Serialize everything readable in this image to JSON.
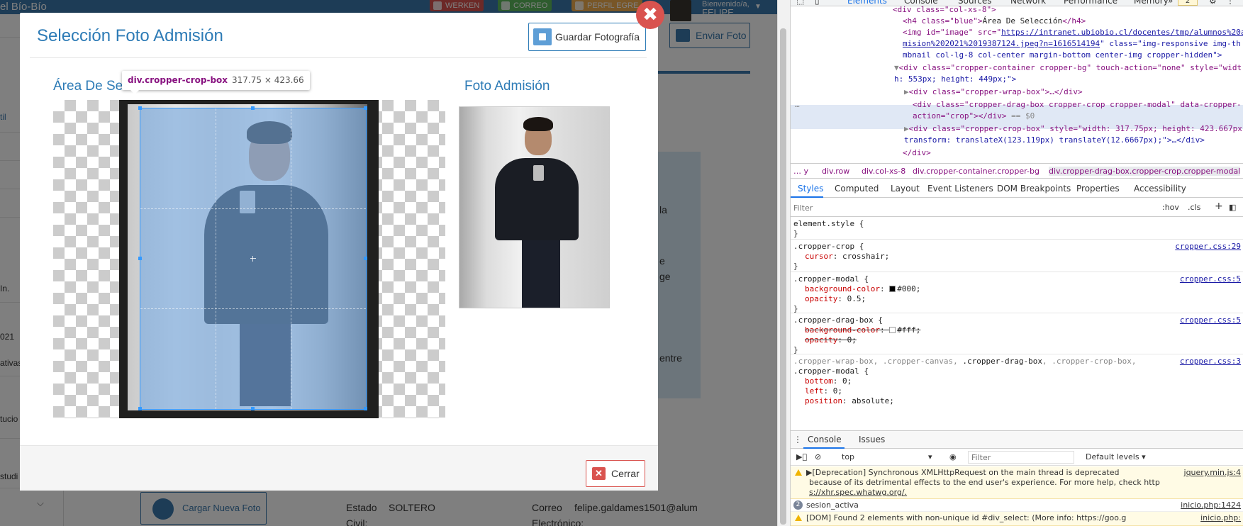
{
  "topbar": {
    "brand": "el Bío-Bío",
    "buttons": [
      "WERKEN",
      "CORREO",
      "PERFIL EGRE"
    ],
    "welcome": "Bienvenido/a,",
    "user": "FELIPE"
  },
  "page": {
    "left_labels": [
      "til",
      "In.",
      "021",
      "ativas",
      "tucio",
      "studi"
    ],
    "send_photo_label": "Enviar Foto",
    "upload_photo_label": "Cargar Nueva Foto",
    "info_snippets": [
      "la",
      "e",
      "ge",
      "entre"
    ],
    "fields": {
      "estado_label": "Estado",
      "estado_label_2": "Civil:",
      "estado_value": "SOLTERO",
      "correo_label": "Correo",
      "correo_label_2": "Electrónico:",
      "correo_value": "felipe.galdames1501@alum"
    }
  },
  "modal": {
    "title": "Selección Foto Admisión",
    "save_label": "Guardar Fotografía",
    "selection_heading": "Área De Selección",
    "preview_heading": "Foto Admisión",
    "close_label": "Cerrar",
    "close_x": "✖",
    "tooltip_tag": "div.cropper-crop-box",
    "tooltip_dims": "317.75 × 423.66"
  },
  "devtools": {
    "tabs": [
      "Elements",
      "Console",
      "Sources",
      "Network",
      "Performance",
      "Memory",
      "»"
    ],
    "warn_count": "2",
    "dom": {
      "l0": "<div class=\"col-xs-8\">",
      "l1_open": "<h4 class=\"blue\">",
      "l1_text": "Área De Selección",
      "l1_close": "</h4>",
      "l2_a": "<img id=\"image\" src=\"",
      "l2_link": "https://intranet.ubiobio.cl/docentes/tmp/alumnos%20a",
      "l3_link": "mision%202021%2019387124.jpeg?n=1616514194",
      "l3_b": "\" class=\"img-responsive img-th",
      "l4": "mbnail col-lg-8 col-center margin-bottom center-img cropper-hidden\">",
      "l5": "<div class=\"cropper-container cropper-bg\" touch-action=\"none\" style=\"widt",
      "l6": "h: 553px; height: 449px;\">",
      "l7": "<div class=\"cropper-wrap-box\">…</div>",
      "l8": "<div class=\"cropper-drag-box cropper-crop cropper-modal\" data-cropper-",
      "l9": "action=\"crop\"></div>",
      "l9_eq": "== $0",
      "l10": "<div class=\"cropper-crop-box\" style=\"width: 317.75px; height: 423.667px",
      "l11": "transform: translateX(123.119px) translateY(12.6667px);\">…</div>",
      "l12": "</div>"
    },
    "breadcrumbs": [
      "… y",
      "div.row",
      "div.col-xs-8",
      "div.cropper-container.cropper-bg",
      "div.cropper-drag-box.cropper-crop.cropper-modal"
    ],
    "subtabs": [
      "Styles",
      "Computed",
      "Layout",
      "Event Listeners",
      "DOM Breakpoints",
      "Properties",
      "Accessibility"
    ],
    "filter_placeholder": "Filter",
    "filter_buttons": [
      ":hov",
      ".cls",
      "+"
    ],
    "styles": {
      "r0_sel": "element.style {",
      "r1_sel": ".cropper-crop {",
      "r1_src": "cropper.css:29",
      "r1_p": "cursor",
      "r1_v": "crosshair;",
      "r2_sel": ".cropper-modal {",
      "r2_src": "cropper.css:5",
      "r2_p1": "background-color",
      "r2_v1": "#000;",
      "r2_p2": "opacity",
      "r2_v2": "0.5;",
      "r3_sel": ".cropper-drag-box {",
      "r3_src": "cropper.css:5",
      "r3_p1": "background-color",
      "r3_v1": "#fff;",
      "r3_p2": "opacity",
      "r3_v2": "0;",
      "r4_sel_a": ".cropper-wrap-box, .cropper-canvas, ",
      "r4_sel_b": ".cropper-drag-box",
      "r4_sel_c": ", .cropper-crop-box,",
      "r4_sel_d": ".cropper-modal {",
      "r4_src": "cropper.css:3",
      "r4_p1": "bottom",
      "r4_v1": "0;",
      "r4_p2": "left",
      "r4_v2": "0;",
      "r4_p3": "position",
      "r4_v3": "absolute;",
      "close": "}"
    },
    "console": {
      "tabs": [
        "Console",
        "Issues"
      ],
      "context": "top",
      "filter_placeholder": "Filter",
      "levels": "Default levels ▾",
      "messages": [
        {
          "text1": "▶[Deprecation] Synchronous XMLHttpRequest on the main thread is deprecated",
          "text2": "because of its detrimental effects to the end user's experience. For more help, check http",
          "text3": "s://xhr.spec.whatwg.org/.",
          "src": "jquery.min.js:4"
        },
        {
          "count": "2",
          "text1": "sesion_activa",
          "src": "inicio.php:1424"
        },
        {
          "text1": "[DOM] Found 2 elements with non-unique id #div_select: (More info: https://goo.g",
          "src": "inicio.php:"
        }
      ]
    }
  },
  "colors": {
    "accent": "#2d7bb6",
    "danger": "#d9534f",
    "crop_overlay": "#78aae1"
  }
}
